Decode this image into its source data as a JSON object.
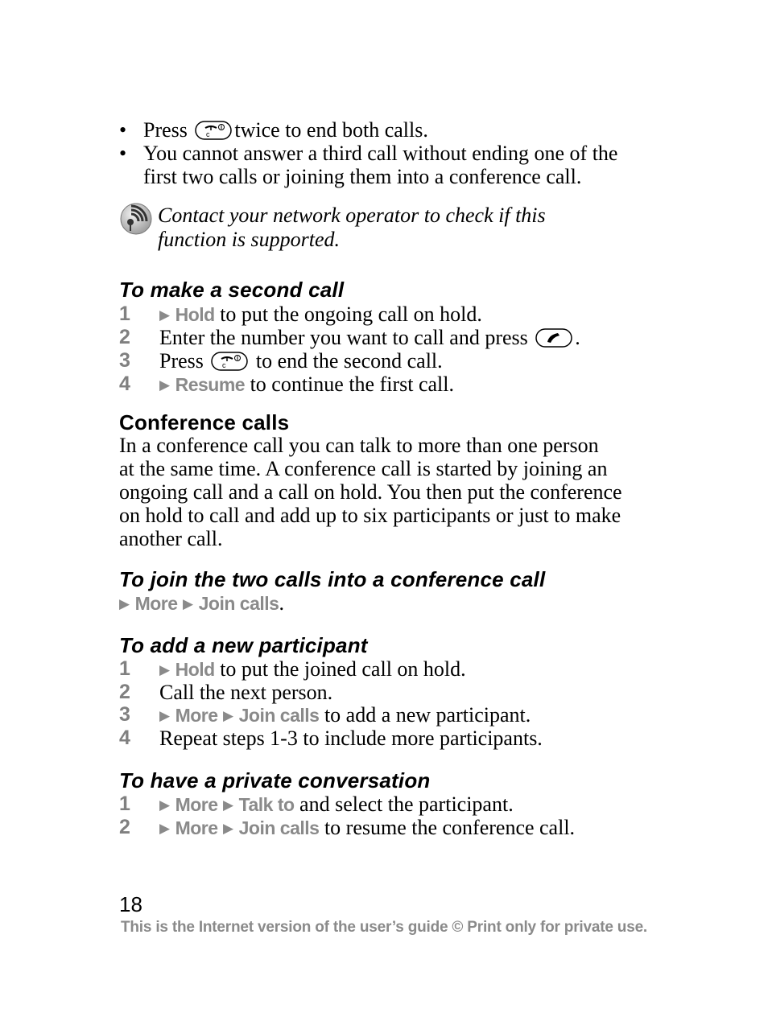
{
  "bullets": [
    {
      "before": "Press",
      "icon": "end-call-key-icon",
      "after": "twice to end both calls."
    },
    {
      "line1": "You cannot answer a third call without ending one of the",
      "line2": "first two calls or joining them into a conference call."
    }
  ],
  "note": {
    "icon": "network-operator-icon",
    "line1": "Contact your network operator to check if this",
    "line2": "function is supported."
  },
  "second_call": {
    "title": "To make a second call",
    "steps": [
      {
        "num": "1",
        "menu": [
          "Hold"
        ],
        "text": "to put the ongoing call on hold."
      },
      {
        "num": "2",
        "text": "Enter the number you want to call and press",
        "icon": "call-key-icon",
        "after": "."
      },
      {
        "num": "3",
        "text": "Press",
        "icon": "end-call-key-icon",
        "after": "to end the second call."
      },
      {
        "num": "4",
        "menu": [
          "Resume"
        ],
        "text": "to continue the first call."
      }
    ]
  },
  "conference": {
    "title": "Conference calls",
    "lines": [
      "In a conference call you can talk to more than one person",
      "at the same time. A conference call is started by joining an",
      "ongoing call and a call on hold. You then put the conference",
      "on hold to call and add up to six participants or just to make",
      "another call."
    ]
  },
  "join": {
    "title": "To join the two calls into a conference call",
    "menu": [
      "More",
      "Join calls"
    ],
    "after": "."
  },
  "add_participant": {
    "title": "To add a new participant",
    "steps": [
      {
        "num": "1",
        "menu": [
          "Hold"
        ],
        "text": "to put the joined call on hold."
      },
      {
        "num": "2",
        "text": "Call the next person."
      },
      {
        "num": "3",
        "menu": [
          "More",
          "Join calls"
        ],
        "text": "to add a new participant."
      },
      {
        "num": "4",
        "text": "Repeat steps 1-3 to include more participants."
      }
    ]
  },
  "private": {
    "title": "To have a private conversation",
    "steps": [
      {
        "num": "1",
        "menu": [
          "More",
          "Talk to"
        ],
        "text": "and select the participant."
      },
      {
        "num": "2",
        "menu": [
          "More",
          "Join calls"
        ],
        "text": "to resume the conference call."
      }
    ]
  },
  "footer": {
    "page_number": "18",
    "notice": "This is the Internet version of the user’s guide © Print only for private use."
  },
  "colors": {
    "menu_gray": "#8a8a8a",
    "step_number_gray": "#808080",
    "text": "#000000"
  }
}
